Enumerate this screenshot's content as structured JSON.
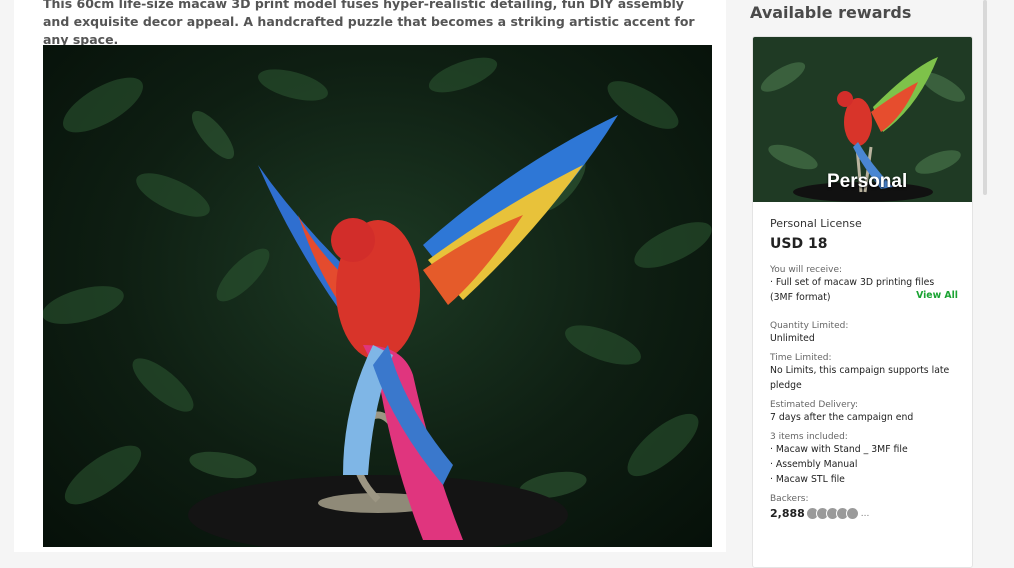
{
  "description": "This 60cm life-size macaw 3D print model fuses hyper-realistic detailing, fun DIY assembly and exquisite decor appeal. A handcrafted puzzle that becomes a striking artistic accent for any space.",
  "sidebar": {
    "title": "Available rewards"
  },
  "reward": {
    "image_caption": "Personal",
    "name": "Personal License",
    "price": "USD 18",
    "receive_label": "You will receive:",
    "receive_item": "· Full set of macaw 3D printing files (3MF format)",
    "view_all": "View All",
    "quantity_label": "Quantity Limited:",
    "quantity_value": "Unlimited",
    "time_label": "Time Limited:",
    "time_value": "No Limits, this campaign supports late pledge",
    "delivery_label": "Estimated Delivery:",
    "delivery_value": "7 days after the campaign end",
    "items_label": "3 items included:",
    "items": [
      "· Macaw with Stand _ 3MF file",
      "· Assembly Manual",
      "· Macaw STL file"
    ],
    "backers_label": "Backers:",
    "backers_count": "2,888",
    "backers_more": "..."
  },
  "colors": {
    "accent_green": "#1aa332",
    "text_dark": "#222222",
    "text_muted": "#666666"
  }
}
